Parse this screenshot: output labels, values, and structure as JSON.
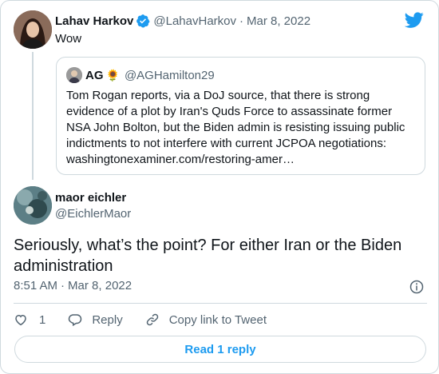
{
  "parent_tweet": {
    "author_name": "Lahav Harkov",
    "handle": "@LahavHarkov",
    "separator": "·",
    "date": "Mar 8, 2022",
    "text": "Wow",
    "verified_icon": "verified-badge-icon"
  },
  "quoted_tweet": {
    "author_name": "AG",
    "emoji": "🌻",
    "handle": "@AGHamilton29",
    "text": "Tom Rogan reports, via a DoJ source, that there is strong evidence of a plot by Iran's Quds Force to assassinate former NSA John Bolton, but the Biden admin is resisting issuing public indictments to not interfere with current JCPOA negotiations: washingtonexaminer.com/restoring-amer…"
  },
  "main_tweet": {
    "author_name": "maor eichler",
    "handle": "@EichlerMaor",
    "text": "Seriously, what’s the point? For either Iran or the Biden administration",
    "time": "8:51 AM",
    "separator": "·",
    "date": "Mar 8, 2022"
  },
  "actions": {
    "like_count": "1",
    "reply_label": "Reply",
    "copy_link_label": "Copy link to Tweet"
  },
  "read_replies_label": "Read 1 reply",
  "colors": {
    "accent": "#1d9bf0",
    "text": "#0f1419",
    "secondary": "#536471",
    "border": "#cfd9de"
  },
  "icons": [
    "twitter-logo-icon",
    "verified-badge-icon",
    "info-icon",
    "heart-icon",
    "reply-icon",
    "link-icon"
  ]
}
